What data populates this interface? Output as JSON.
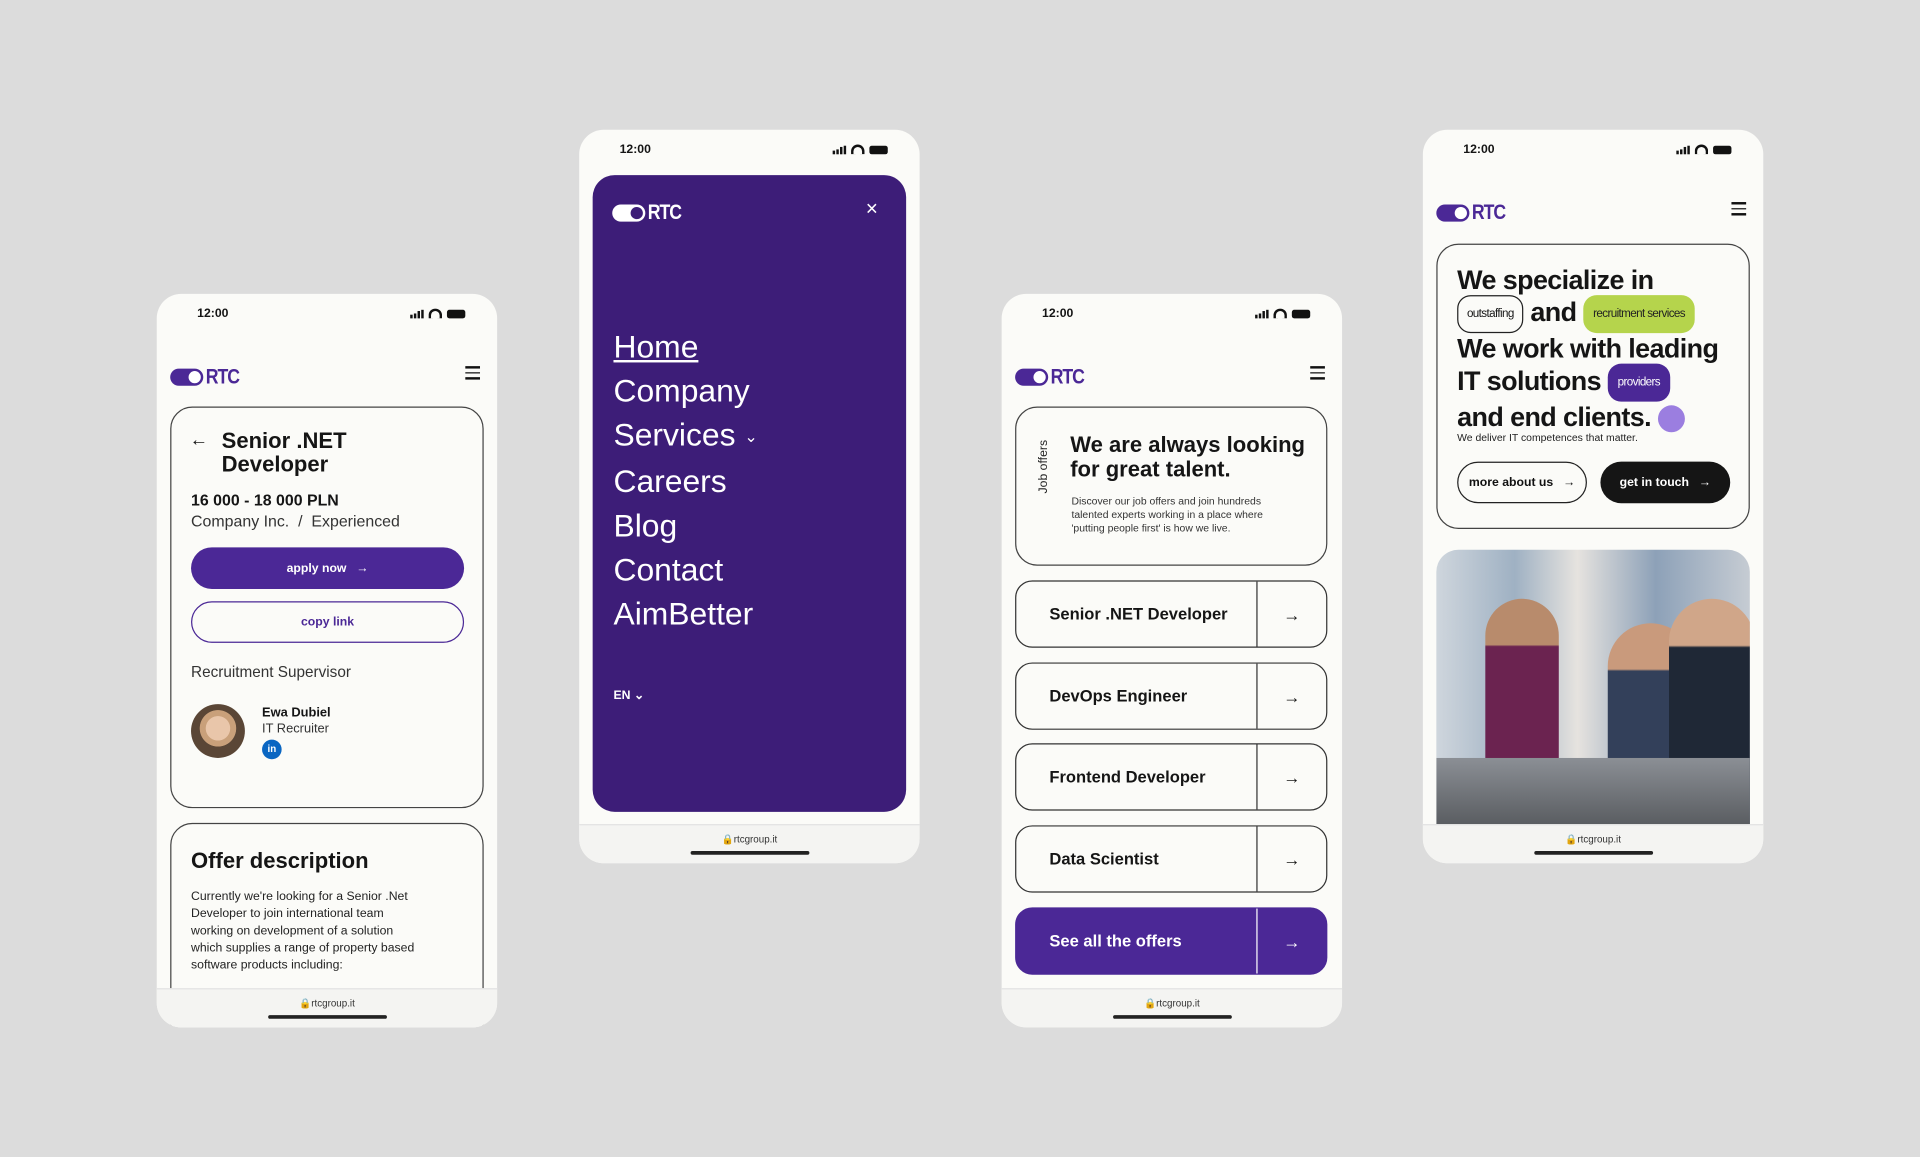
{
  "status": {
    "time": "12:00"
  },
  "brand": {
    "logo": "RTC",
    "url": "rtcgroup.it"
  },
  "colors": {
    "purple": "#4b2896",
    "menu_bg": "#3d1d78",
    "green": "#b5d44c",
    "lilac": "#9b7ee0",
    "background": "#dcdcdc"
  },
  "job_detail": {
    "title_line1": "Senior .NET",
    "title_line2": "Developer",
    "salary": "16 000 - 18 000 PLN",
    "company": "Company Inc.",
    "separator": "/",
    "level": "Experienced",
    "apply_label": "apply now",
    "copy_label": "copy link",
    "supervisor_heading": "Recruitment Supervisor",
    "recruiter": {
      "name": "Ewa Dubiel",
      "role": "IT Recruiter",
      "social": "linkedin-icon"
    },
    "offer_title": "Offer description",
    "offer_lines": [
      "Currently we're looking for a Senior .Net",
      "Developer to join international team",
      "working on development of a solution",
      "which supplies a range of property based",
      "software products including:"
    ]
  },
  "menu": {
    "items": [
      "Home",
      "Company",
      "Services",
      "Careers",
      "Blog",
      "Contact",
      "AimBetter"
    ],
    "language": "EN"
  },
  "jobs": {
    "side_label": "Job offers",
    "heading_line1": "We are always looking",
    "heading_line2": "for great talent.",
    "desc_lines": [
      "Discover our job offers and join hundreds",
      "talented experts working in a place where",
      "'putting people first' is how we live."
    ],
    "offers": [
      "Senior .NET Developer",
      "DevOps Engineer",
      "Frontend Developer",
      "Data Scientist"
    ],
    "see_all": "See all the offers"
  },
  "home": {
    "line1": "We specialize in",
    "tag_outstaffing": "outstaffing",
    "and": "and",
    "tag_recruitment": "recruitment services",
    "line3": "We work with leading",
    "line4": "IT solutions",
    "tag_providers": "providers",
    "line5": "and end clients.",
    "subtitle": "We deliver IT competences that matter.",
    "more_label": "more about us",
    "contact_label": "get in touch"
  }
}
